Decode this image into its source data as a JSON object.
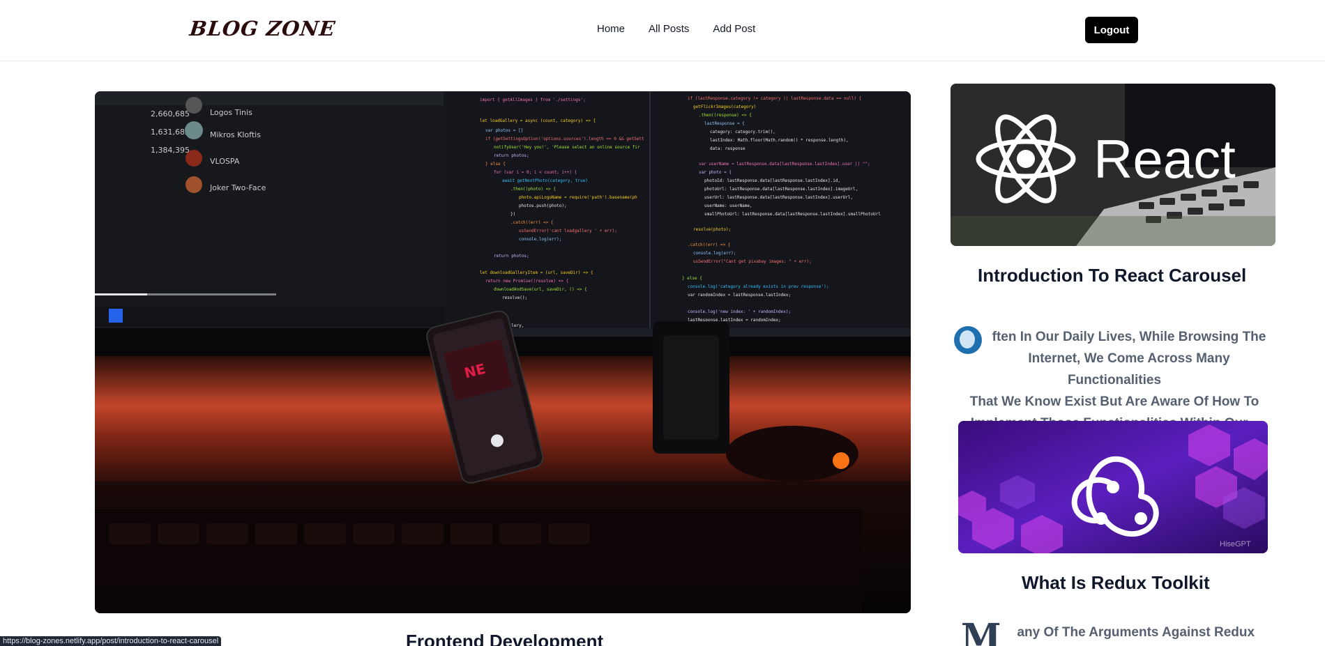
{
  "header": {
    "logo": "BLOG ZONE",
    "nav": [
      {
        "label": "Home"
      },
      {
        "label": "All Posts"
      },
      {
        "label": "Add Post"
      }
    ],
    "logout_label": "Logout"
  },
  "hero": {
    "title": "Frontend Development"
  },
  "sidebar": {
    "cards": [
      {
        "image_text": "React",
        "title": "Introduction To React Carousel",
        "dropcap": "O",
        "excerpt_lines": [
          "ften In Our Daily Lives, While Browsing The",
          "Internet, We Come Across Many Functionalities",
          "That We Know Exist But Are Aware Of How To",
          "Implement Those Functionalities Within Our..."
        ]
      },
      {
        "image_text": "HiseGPT",
        "title": "What Is Redux Toolkit",
        "dropcap": "M",
        "excerpt_lines": [
          "any Of The Arguments Against Redux Were"
        ]
      }
    ]
  },
  "status_bar": {
    "url": "https://blog-zones.netlify.app/post/introduction-to-react-carousel"
  }
}
